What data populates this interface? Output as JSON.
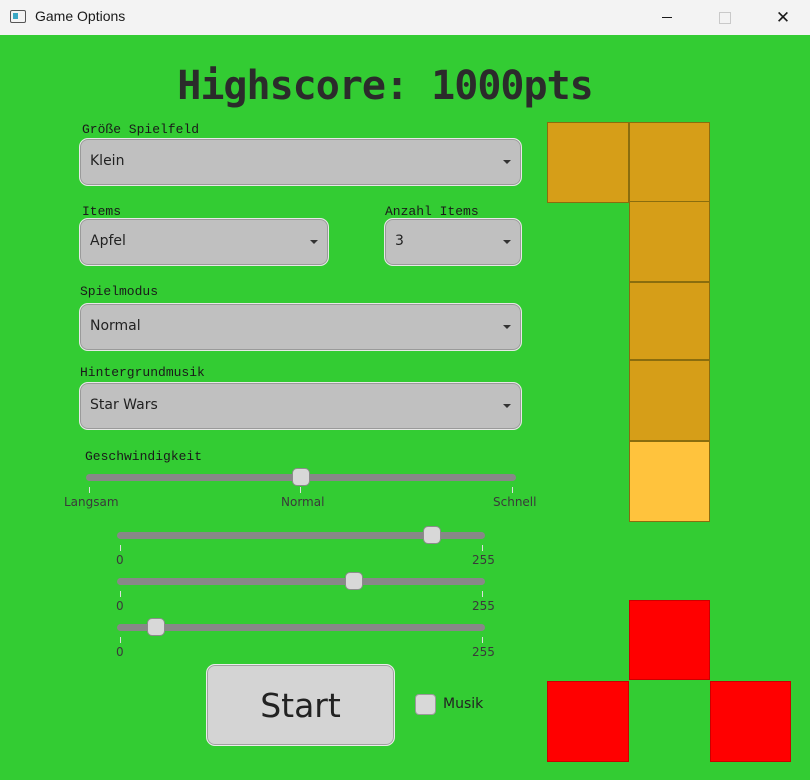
{
  "window": {
    "title": "Game Options",
    "minimize_glyph": "—",
    "close_glyph": "✕"
  },
  "highscore": "Highscore: 1000pts",
  "fields": {
    "groesse": {
      "label": "Größe Spielfeld",
      "value": "Klein"
    },
    "items": {
      "label": "Items",
      "value": "Apfel"
    },
    "anzahl": {
      "label": "Anzahl Items",
      "value": "3"
    },
    "spielmodus": {
      "label": "Spielmodus",
      "value": "Normal"
    },
    "musik": {
      "label": "Hintergrundmusik",
      "value": "Star Wars"
    }
  },
  "speed": {
    "label": "Geschwindigkeit",
    "min_label": "Langsam",
    "mid_label": "Normal",
    "max_label": "Schnell",
    "value": 0.5
  },
  "color_sliders": [
    {
      "min": "0",
      "max": "255",
      "value": 220
    },
    {
      "min": "0",
      "max": "255",
      "value": 165
    },
    {
      "min": "0",
      "max": "255",
      "value": 25
    }
  ],
  "start_label": "Start",
  "musik_checkbox": {
    "label": "Musik",
    "checked": false
  },
  "colors": {
    "background": "#33cc33",
    "snake_body": "#d69e18",
    "snake_head": "#ffc33d",
    "obstacle": "#ff0000"
  }
}
